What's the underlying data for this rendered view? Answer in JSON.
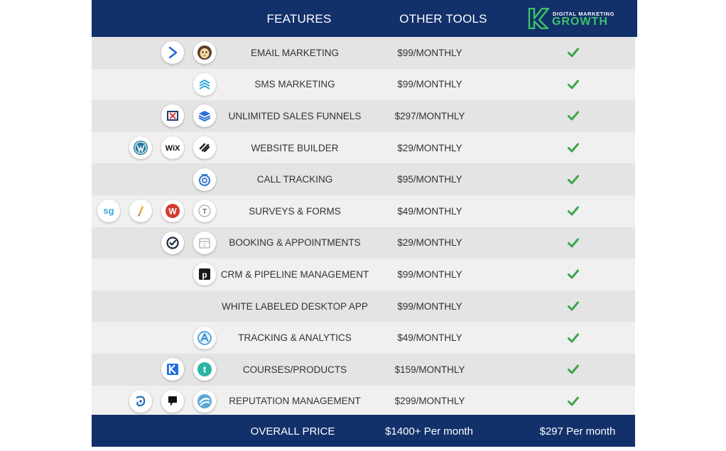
{
  "header": {
    "features": "FEATURES",
    "other_tools": "OTHER TOOLS",
    "logo_top": "DIGITAL MARKETING",
    "logo_bottom": "GROWTH"
  },
  "colors": {
    "header_bg": "#12306a",
    "row_dark": "#e4e4e4",
    "row_light": "#f0f0f0",
    "check": "#3aa64a",
    "logo_green": "#3cc36a"
  },
  "rows": [
    {
      "feature": "EMAIL MARKETING",
      "price": "$99/MONTHLY",
      "icons": [
        "activecampaign-icon",
        "mailchimp-icon"
      ]
    },
    {
      "feature": "SMS MARKETING",
      "price": "$99/MONTHLY",
      "icons": [
        "sms-stack-icon"
      ]
    },
    {
      "feature": "UNLIMITED SALES FUNNELS",
      "price": "$297/MONTHLY",
      "icons": [
        "clickfunnels-icon",
        "leadpages-icon"
      ]
    },
    {
      "feature": "WEBSITE BUILDER",
      "price": "$29/MONTHLY",
      "icons": [
        "wordpress-icon",
        "wix-icon",
        "squarespace-icon"
      ]
    },
    {
      "feature": "CALL TRACKING",
      "price": "$95/MONTHLY",
      "icons": [
        "callrail-icon"
      ]
    },
    {
      "feature": "SURVEYS & FORMS",
      "price": "$49/MONTHLY",
      "icons": [
        "surveygizmo-icon",
        "jotform-icon",
        "wufoo-icon",
        "typeform-icon"
      ]
    },
    {
      "feature": "BOOKING & APPOINTMENTS",
      "price": "$29/MONTHLY",
      "icons": [
        "acuity-icon",
        "calendly-icon"
      ]
    },
    {
      "feature": "CRM & PIPELINE MANAGEMENT",
      "price": "$99/MONTHLY",
      "icons": [
        "pipedrive-icon"
      ]
    },
    {
      "feature": "WHITE LABELED DESKTOP APP",
      "price": "$99/MONTHLY",
      "icons": []
    },
    {
      "feature": "TRACKING & ANALYTICS",
      "price": "$49/MONTHLY",
      "icons": [
        "analytics-icon"
      ]
    },
    {
      "feature": "COURSES/PRODUCTS",
      "price": "$159/MONTHLY",
      "icons": [
        "kajabi-icon",
        "teachable-icon"
      ]
    },
    {
      "feature": "REPUTATION MANAGEMENT",
      "price": "$299/MONTHLY",
      "icons": [
        "birdeye-icon",
        "podium-icon",
        "reviews-icon"
      ]
    }
  ],
  "footer": {
    "label": "OVERALL PRICE",
    "other_total": "$1400+ Per month",
    "our_total": "$297 Per month"
  }
}
